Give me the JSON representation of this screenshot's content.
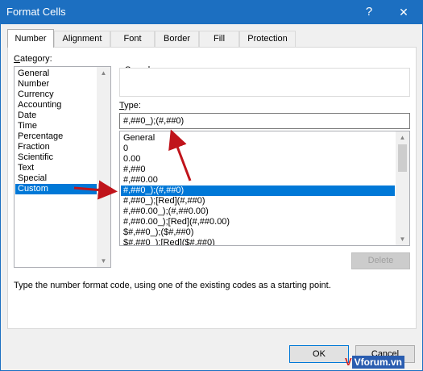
{
  "window": {
    "title": "Format Cells",
    "help_icon": "?",
    "close_icon": "✕"
  },
  "tabs": [
    {
      "label": "Number",
      "active": true
    },
    {
      "label": "Alignment"
    },
    {
      "label": "Font"
    },
    {
      "label": "Border"
    },
    {
      "label": "Fill"
    },
    {
      "label": "Protection"
    }
  ],
  "category": {
    "label_first": "C",
    "label_rest": "ategory:",
    "items": [
      "General",
      "Number",
      "Currency",
      "Accounting",
      "Date",
      "Time",
      "Percentage",
      "Fraction",
      "Scientific",
      "Text",
      "Special",
      "Custom"
    ],
    "selected": "Custom"
  },
  "sample": {
    "label": "Sample",
    "value": ""
  },
  "type": {
    "label_first": "T",
    "label_rest": "ype:",
    "value": "#,##0_);(#,##0)"
  },
  "formats": {
    "items": [
      "General",
      "0",
      "0.00",
      "#,##0",
      "#,##0.00",
      "#,##0_);(#,##0)",
      "#,##0_);[Red](#,##0)",
      "#,##0.00_);(#,##0.00)",
      "#,##0.00_);[Red](#,##0.00)",
      "$#,##0_);($#,##0)",
      "$#,##0_);[Red]($#,##0)"
    ],
    "selected": "#,##0_);(#,##0)"
  },
  "buttons": {
    "delete": "Delete",
    "ok": "OK",
    "cancel": "Cancel"
  },
  "hint": "Type the number format code, using one of the existing codes as a starting point.",
  "watermark": {
    "mark": "V",
    "text": "Vforum.vn"
  },
  "colors": {
    "titlebar": "#1c6fc1",
    "selection": "#0078d7",
    "annotation_arrow": "#c0141b"
  },
  "icons": {
    "scroll_up": "▲",
    "scroll_down": "▼"
  }
}
